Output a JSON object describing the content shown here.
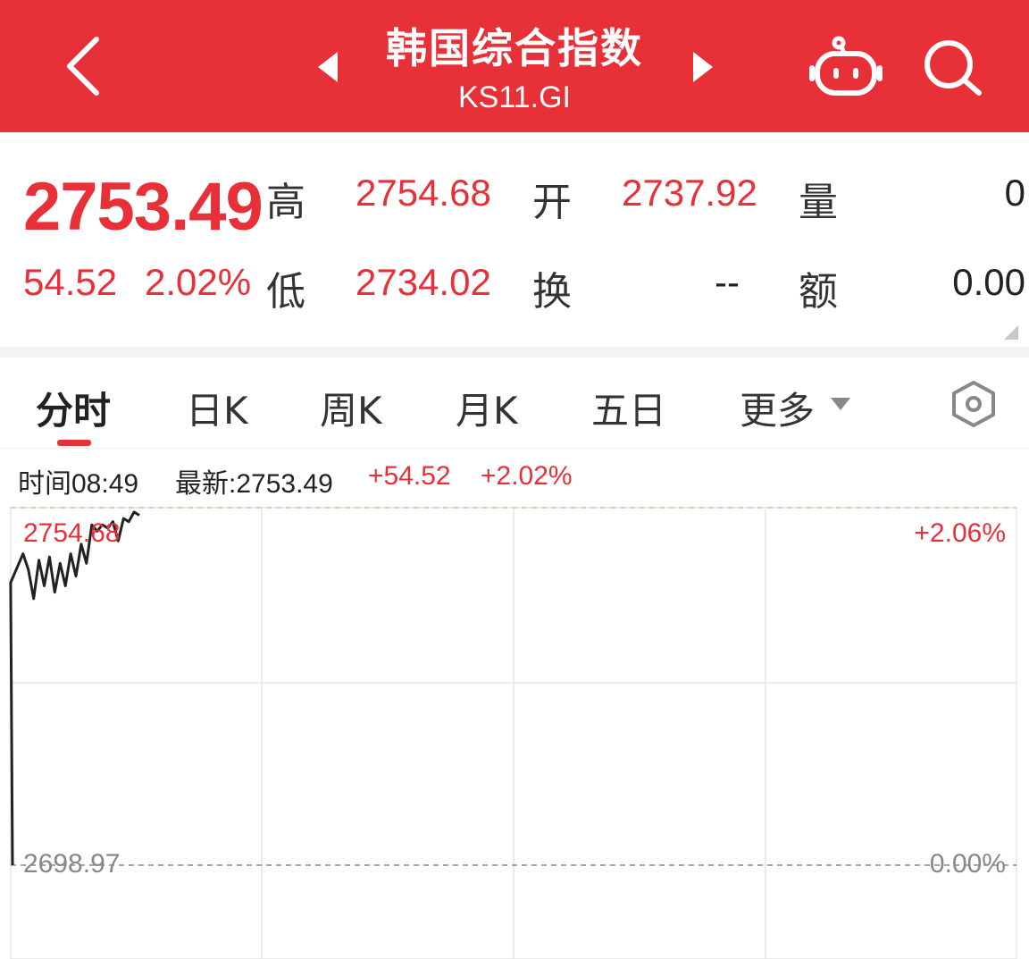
{
  "header": {
    "title": "韩国综合指数",
    "subtitle": "KS11.GI",
    "bg_color": "#e83038"
  },
  "icons": {
    "back": "back-arrow-icon",
    "prev": "prev-triangle-icon",
    "next": "next-triangle-icon",
    "robot": "robot-assistant-icon",
    "search": "search-icon",
    "settings": "hexagon-settings-icon"
  },
  "quote": {
    "price": "2753.49",
    "change_abs": "54.52",
    "change_pct": "2.02%",
    "high_label": "高",
    "high": "2754.68",
    "open_label": "开",
    "open": "2737.92",
    "volume_label": "量",
    "volume": "0",
    "low_label": "低",
    "low": "2734.02",
    "turnover_label": "换",
    "turnover": "--",
    "amount_label": "额",
    "amount": "0.00"
  },
  "tabs": [
    {
      "label": "分时",
      "active": true
    },
    {
      "label": "日K",
      "active": false
    },
    {
      "label": "周K",
      "active": false
    },
    {
      "label": "月K",
      "active": false
    },
    {
      "label": "五日",
      "active": false
    },
    {
      "label": "更多",
      "active": false
    }
  ],
  "info": {
    "time": "时间08:49",
    "latest": "最新:2753.49",
    "change_abs": "+54.52",
    "change_pct": "+2.02%"
  },
  "chart_data": {
    "type": "line",
    "series": [
      {
        "values": [
          2698.97,
          2743.0,
          2747.5,
          2745.0,
          2740.5,
          2746.5,
          2742.5,
          2747.0,
          2741.5,
          2746.0,
          2742.5,
          2747.5,
          2744.0,
          2749.0,
          2746.0,
          2752.0,
          2751.0,
          2752.0,
          2751.5,
          2752.5,
          2749.5,
          2753.0,
          2752.5,
          2754.0,
          2753.49
        ]
      }
    ],
    "ylim": [
      2698.97,
      2754.68
    ],
    "y_tick_left_top": "2754.68",
    "y_tick_left_bottom": "2698.97",
    "y_tick_right_top": "+2.06%",
    "y_tick_right_bottom": "0.00%",
    "grid": true,
    "line_color": "#222222",
    "accent_color": "#e83038"
  }
}
